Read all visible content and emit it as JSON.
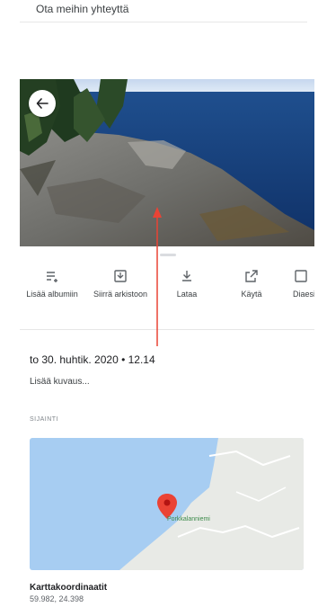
{
  "top_section": {
    "text": "Ota meihin yhteyttä"
  },
  "photo": {
    "description_hidden": true
  },
  "actions": [
    {
      "label": "Lisää albumiin",
      "icon": "add-to-playlist-icon"
    },
    {
      "label": "Siirrä arkistoon",
      "icon": "archive-icon"
    },
    {
      "label": "Lataa",
      "icon": "download-icon"
    },
    {
      "label": "Käytä",
      "icon": "open-external-icon"
    },
    {
      "label": "Diaesitys",
      "icon": "slideshow-icon"
    }
  ],
  "details": {
    "date_time": "to 30. huhtik. 2020 • 12.14",
    "add_description": "Lisää kuvaus...",
    "location_section_label": "SIJAINTI",
    "map_place_label": "Porkkalanniemi",
    "coords_title": "Karttakoordinaatit",
    "coords_value": "59.982, 24.398"
  },
  "colors": {
    "accent_red": "#ea4335",
    "water": "#a7cdf2",
    "land": "#e8eae6"
  }
}
